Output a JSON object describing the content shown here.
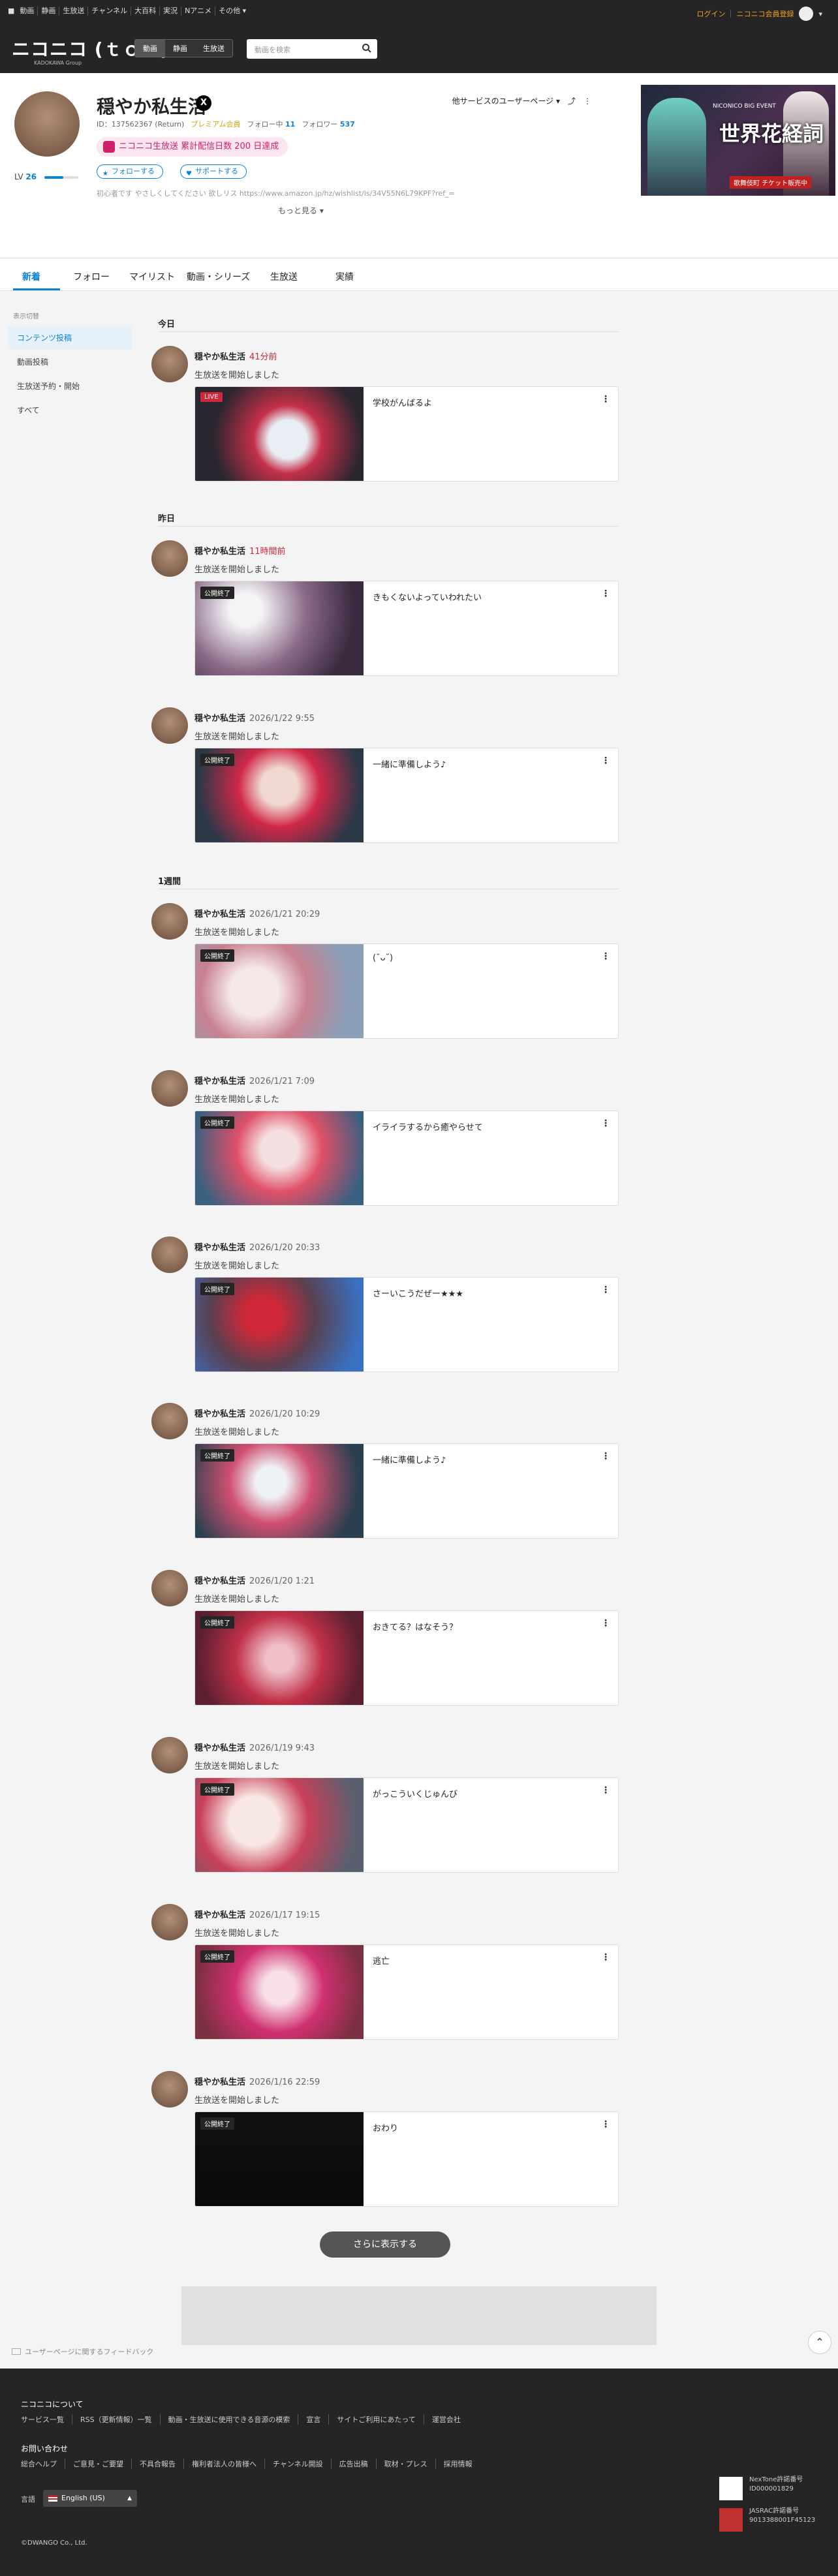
{
  "topbar": {
    "nav": [
      "動画",
      "静画",
      "生放送",
      "チャンネル",
      "大百科",
      "実況",
      "Nアニメ",
      "その他"
    ],
    "login": "ログイン",
    "register": "ニコニコ会員登録"
  },
  "header": {
    "logo": "ニコニコ (ｔｏｉ)",
    "logo_sub": "KADOKAWA Group",
    "segments": [
      "動画",
      "静画",
      "生放送"
    ],
    "search_placeholder": "動画を検索"
  },
  "profile": {
    "name": "穏やか私生活",
    "x_icon": "X",
    "id_text": "ID：137562367 (Return)",
    "premium": "プレミアム会員",
    "follow_label": "フォロー中",
    "follow_count": "11",
    "follower_label": "フォロワー",
    "follower_count": "537",
    "badge": "ニコニコ生放送 累計配信日数 200 日達成",
    "level_label": "LV",
    "level": "26",
    "level_progress": 0.55,
    "follow_button": "フォローする",
    "support_button": "サポートする",
    "description": "初心者です やさしくしてください 欲しリス https://www.amazon.jp/hz/wishlist/ls/34V55N6L79KPF?ref_=",
    "more": "もっと見る",
    "other_services": "他サービスのユーザーページ",
    "banner_title": "世界花経詞",
    "banner_sub": "NICONICO BIG EVENT",
    "banner_tag": "歌舞伎町 チケット販売中"
  },
  "tabs": [
    "新着",
    "フォロー",
    "マイリスト",
    "動画・シリーズ",
    "生放送",
    "実績"
  ],
  "sidebar": {
    "heading": "表示切替",
    "items": [
      "コンテンツ投稿",
      "動画投稿",
      "生放送予約・開始",
      "すべて"
    ]
  },
  "sections": [
    "今日",
    "昨日",
    "1週間"
  ],
  "posts": [
    {
      "author": "穏やか私生活",
      "time": "41分前",
      "action": "生放送を開始しました",
      "tag": "LIVE",
      "title": "学校がんばるよ"
    },
    {
      "author": "穏やか私生活",
      "time": "11時間前",
      "action": "生放送を開始しました",
      "tag": "公開終了",
      "title": "きもくないよっていわれたい"
    },
    {
      "author": "穏やか私生活",
      "time": "2026/1/22 9:55",
      "action": "生放送を開始しました",
      "tag": "公開終了",
      "title": "一緒に準備しよう♪"
    },
    {
      "author": "穏やか私生活",
      "time": "2026/1/21 20:29",
      "action": "生放送を開始しました",
      "tag": "公開終了",
      "title": "(˘ᴗ˘)"
    },
    {
      "author": "穏やか私生活",
      "time": "2026/1/21 7:09",
      "action": "生放送を開始しました",
      "tag": "公開終了",
      "title": "イライラするから癒やらせて"
    },
    {
      "author": "穏やか私生活",
      "time": "2026/1/20 20:33",
      "action": "生放送を開始しました",
      "tag": "公開終了",
      "title": "さーいこうだぜー★★★"
    },
    {
      "author": "穏やか私生活",
      "time": "2026/1/20 10:29",
      "action": "生放送を開始しました",
      "tag": "公開終了",
      "title": "一緒に準備しよう♪"
    },
    {
      "author": "穏やか私生活",
      "time": "2026/1/20 1:21",
      "action": "生放送を開始しました",
      "tag": "公開終了",
      "title": "おきてる？はなそう？"
    },
    {
      "author": "穏やか私生活",
      "time": "2026/1/19 9:43",
      "action": "生放送を開始しました",
      "tag": "公開終了",
      "title": "がっこういくじゅんび"
    },
    {
      "author": "穏やか私生活",
      "time": "2026/1/17 19:15",
      "action": "生放送を開始しました",
      "tag": "公開終了",
      "title": "逃亡"
    },
    {
      "author": "穏やか私生活",
      "time": "2026/1/16 22:59",
      "action": "生放送を開始しました",
      "tag": "公開終了",
      "title": "おわり"
    }
  ],
  "more_button": "さらに表示する",
  "feedback": "ユーザーページに関するフィードバック",
  "footer": {
    "about": "ニコニコについて",
    "links1": [
      "サービス一覧",
      "RSS（更新情報）一覧",
      "動画・生放送に使用できる音源の模索",
      "宣言",
      "サイトご利用にあたって",
      "運営会社"
    ],
    "contact": "お問い合わせ",
    "links2": [
      "総合ヘルプ",
      "ご意見・ご要望",
      "不具合報告",
      "権利者法人の皆様へ",
      "チャンネル開設",
      "広告出稿",
      "取材・プレス",
      "採用情報"
    ],
    "language_label": "言語",
    "language": "English (US)",
    "copyright": "©DWANGO Co., Ltd.",
    "license1_name": "NexTone許諾番号",
    "license1_no": "ID000001829",
    "license2_name": "JASRAC許諾番号",
    "license2_no": "9013388001F45123"
  },
  "colors": {
    "accent": "#0b83d4",
    "live": "#d0283a",
    "premium": "#d4a017",
    "badge": "#d0206d"
  }
}
